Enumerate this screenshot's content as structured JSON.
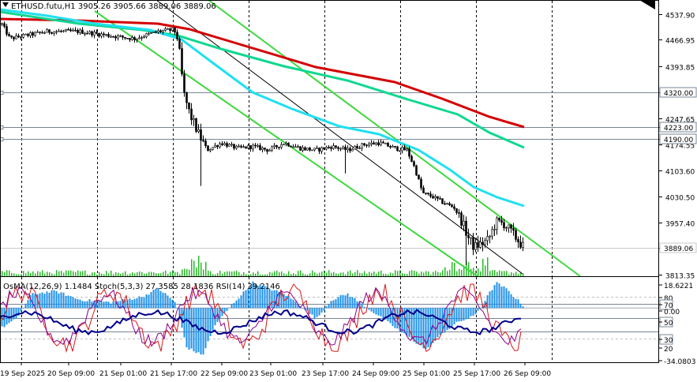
{
  "header": {
    "symbol_line": "ETHUSD.futu,H1  3905.26 3905.66 3889.06 3889.06",
    "indicator_line": "OsMA(12,26,9) 1.1484  Stoch(5,3,3) 27.3585 28.1836  RSI(14) 39.2146"
  },
  "price_axis": {
    "ticks": [
      "4537.90",
      "4466.95",
      "4393.85",
      "4320.00",
      "4247.65",
      "4223.00",
      "4190.00",
      "4174.55",
      "4103.60",
      "4030.50",
      "3957.40",
      "3889.06",
      "3813.35"
    ],
    "ymin": 3813.35,
    "ymax": 4571
  },
  "level_labels": [
    {
      "value": 4320.0,
      "text": "4320.00"
    },
    {
      "value": 4223.0,
      "text": "4223.00"
    },
    {
      "value": 4190.0,
      "text": "4190.00"
    }
  ],
  "current_price_label": "3889.06",
  "indicator_axis": {
    "labels": [
      "18.6221",
      "80",
      "70",
      "0.00",
      "50",
      "30",
      "20",
      "-34.0803"
    ],
    "highlighted": [
      "70",
      "50",
      "30"
    ]
  },
  "time_axis": {
    "labels": [
      "19 Sep 2025",
      "20 Sep 09:00",
      "21 Sep 01:00",
      "21 Sep 17:00",
      "22 Sep 09:00",
      "23 Sep 01:00",
      "23 Sep 17:00",
      "24 Sep 09:00",
      "25 Sep 01:00",
      "25 Sep 17:00",
      "26 Sep 09:00"
    ]
  },
  "colors": {
    "candles": "#000000",
    "ma_red": "#d40000",
    "ma_green": "#10d890",
    "ma_cyan": "#20e0f0",
    "channel": "#3cd83c",
    "osma": "#1e90e8",
    "stoch_main": "#d81818",
    "stoch_signal": "#8b008b",
    "rsi": "#00008b",
    "volume": "#2ab82a"
  },
  "chart_data": [
    {
      "type": "candlestick",
      "title": "ETHUSD.futu,H1",
      "ohlc_last": {
        "open": 3905.26,
        "high": 3905.66,
        "low": 3889.06,
        "close": 3889.06
      },
      "x": [
        "19 Sep 2025",
        "20 Sep 09:00",
        "21 Sep 01:00",
        "21 Sep 17:00",
        "22 Sep 09:00",
        "23 Sep 01:00",
        "23 Sep 17:00",
        "24 Sep 09:00",
        "25 Sep 01:00",
        "25 Sep 17:00",
        "26 Sep 09:00"
      ],
      "close_approx": [
        4470,
        4490,
        4475,
        4480,
        4150,
        4170,
        4175,
        4165,
        4040,
        3910,
        3889
      ],
      "ylim": [
        3813.35,
        4571
      ],
      "series": [
        {
          "name": "MA red",
          "values": [
            4520,
            4510,
            4495,
            4480,
            4420,
            4370,
            4320,
            4290,
            4270,
            4230,
            4225
          ]
        },
        {
          "name": "MA green",
          "values": [
            4540,
            4520,
            4500,
            4480,
            4400,
            4340,
            4290,
            4260,
            4225,
            4180,
            4160
          ]
        },
        {
          "name": "MA cyan",
          "values": [
            4535,
            4510,
            4490,
            4470,
            4330,
            4250,
            4215,
            4195,
            4150,
            4040,
            4000
          ]
        }
      ],
      "horizontal_levels": [
        4320.0,
        4223.0,
        4190.0,
        3889.06
      ],
      "grid": true
    },
    {
      "type": "bar",
      "title": "OsMA(12,26,9)",
      "current": 1.1484,
      "ylim": [
        -34.0803,
        18.6221
      ]
    },
    {
      "type": "line",
      "title": "Stoch(5,3,3) / RSI(14)",
      "series": [
        {
          "name": "Stoch main",
          "current": 27.3585
        },
        {
          "name": "Stoch signal",
          "current": 28.1836
        },
        {
          "name": "RSI(14)",
          "current": 39.2146
        }
      ],
      "levels": [
        80,
        70,
        50,
        30,
        20
      ],
      "ylim": [
        0,
        100
      ]
    }
  ]
}
